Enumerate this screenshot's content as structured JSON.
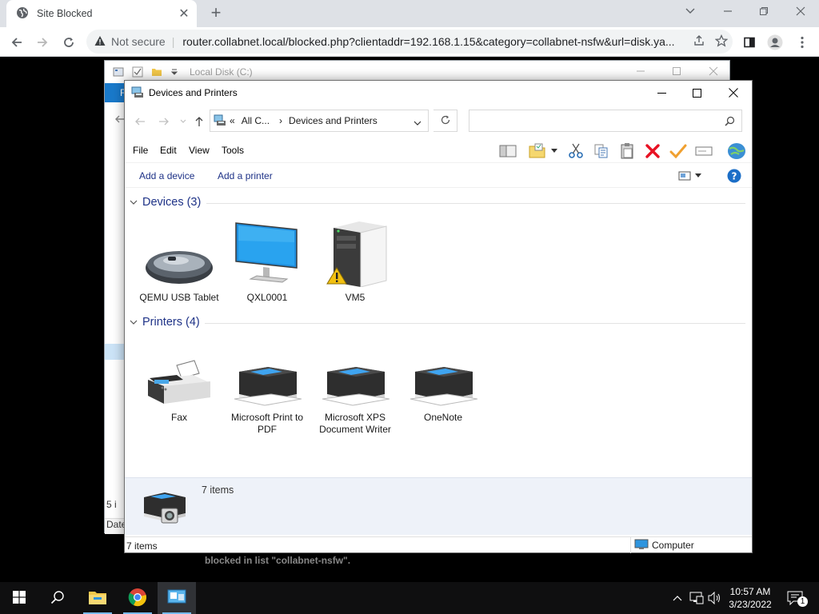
{
  "browser": {
    "tab_title": "Site Blocked",
    "tab_close": "✕",
    "new_tab": "+",
    "not_secure": "Not secure",
    "url": "router.collabnet.local/blocked.php?clientaddr=192.168.1.15&category=collabnet-nsfw&url=disk.ya..."
  },
  "bg_window": {
    "title": "Local Disk (C:)",
    "ribbon_letter": "F",
    "status_prefix": "5 i",
    "column_prefix": "Date"
  },
  "page": {
    "blocked_text": "blocked in list \"collabnet-nsfw\"."
  },
  "devices_printers": {
    "title": "Devices and Printers",
    "address": {
      "root_chevron": "«",
      "crumb1": "All C...",
      "crumb_sep": "›",
      "crumb2": "Devices and Printers"
    },
    "menu": [
      "File",
      "Edit",
      "View",
      "Tools"
    ],
    "commands": {
      "add_device": "Add a device",
      "add_printer": "Add a printer"
    },
    "groups": {
      "devices": {
        "label": "Devices (3)",
        "items": [
          "QEMU USB Tablet",
          "QXL0001",
          "VM5"
        ]
      },
      "printers": {
        "label": "Printers (4)",
        "items": [
          "Fax",
          "Microsoft Print to PDF",
          "Microsoft XPS Document Writer",
          "OneNote"
        ]
      }
    },
    "details": {
      "count": "7 items"
    },
    "status": {
      "left": "7 items",
      "right": "Computer"
    }
  },
  "taskbar": {
    "time": "10:57 AM",
    "date": "3/23/2022",
    "notification_count": "1"
  },
  "colors": {
    "accent_blue": "#1979ca",
    "group_header": "#1e3287",
    "delete_red": "#e81123",
    "check_orange": "#f0a030"
  }
}
